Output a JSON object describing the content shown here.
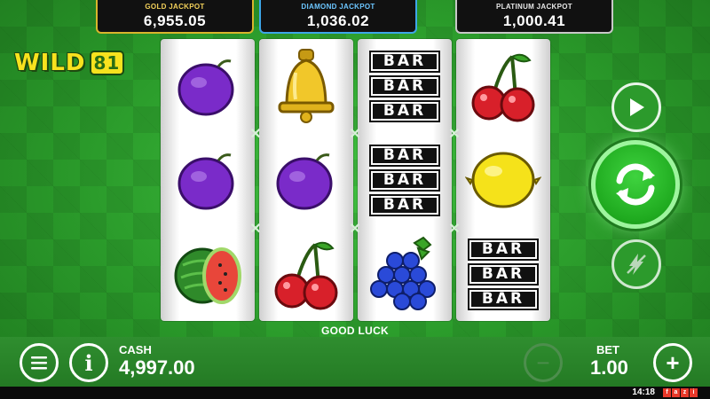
{
  "jackpots": {
    "gold": {
      "label": "GOLD JACKPOT",
      "value": "6,955.05"
    },
    "diamond": {
      "label": "DIAMOND JACKPOT",
      "value": "1,036.02"
    },
    "platinum": {
      "label": "PLATINUM JACKPOT",
      "value": "1,000.41"
    }
  },
  "logo": {
    "word": "WILD",
    "number": "81"
  },
  "reels": [
    [
      "plum-icon",
      "plum-icon",
      "watermelon-icon"
    ],
    [
      "bell-icon",
      "plum-icon",
      "cherries-icon"
    ],
    [
      "bar-icon",
      "bar-icon",
      "grapes-icon"
    ],
    [
      "cherries-icon",
      "lemon-icon",
      "bar-icon"
    ]
  ],
  "bar_text": "BAR",
  "status_message": "GOOD LUCK",
  "cash": {
    "label": "CASH",
    "value": "4,997.00"
  },
  "bet": {
    "label": "BET",
    "value": "1.00"
  },
  "controls": {
    "minus": "−",
    "plus": "+",
    "info": "i"
  },
  "clock": "14:18",
  "brand": [
    "f",
    "a",
    "z",
    "i"
  ],
  "colors": {
    "accent_green": "#2a9a2a",
    "spin_glow": "#9ef59e",
    "gold": "#d9b52c",
    "diamond": "#3da6e8",
    "platinum": "#c8c8c8"
  }
}
